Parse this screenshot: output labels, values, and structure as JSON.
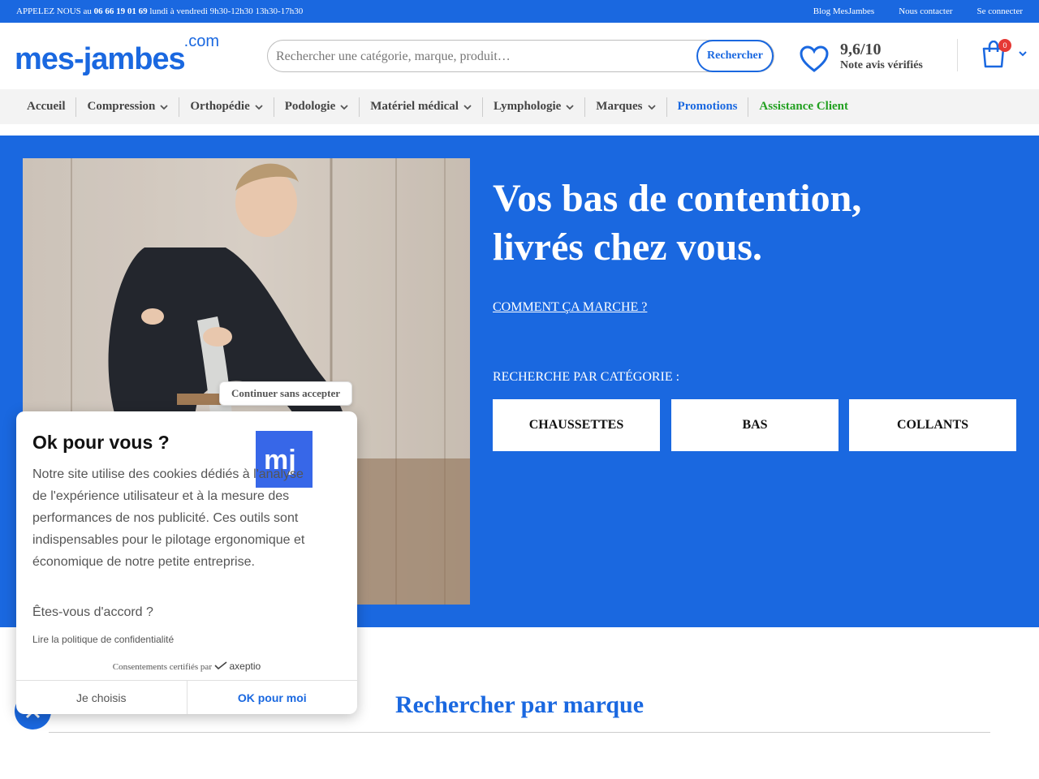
{
  "topbar": {
    "call_prefix": "APPELEZ NOUS au ",
    "phone": "06 66 19 01 69",
    "hours": " lundi à vendredi 9h30-12h30 13h30-17h30",
    "links": [
      "Blog MesJambes",
      "Nous contacter",
      "Se connecter"
    ]
  },
  "header": {
    "logo_main": "mes-jambes",
    "logo_com": ".com",
    "search_placeholder": "Rechercher une catégorie, marque, produit…",
    "search_button": "Rechercher",
    "rating_score": "9,6/10",
    "rating_label": "Note avis vérifiés",
    "cart_count": "0"
  },
  "nav": {
    "items": [
      "Accueil",
      "Compression",
      "Orthopédie",
      "Podologie",
      "Matériel médical",
      "Lymphologie",
      "Marques",
      "Promotions",
      "Assistance Client"
    ]
  },
  "hero": {
    "title_line1": "Vos bas de contention,",
    "title_line2": "livrés chez vous.",
    "how_link": "COMMENT ÇA MARCHE ?",
    "category_label": "RECHERCHE PAR CATÉGORIE :",
    "categories": [
      "CHAUSSETTES",
      "BAS",
      "COLLANTS"
    ]
  },
  "brands": {
    "title": "Rechercher par marque"
  },
  "cookie": {
    "continue": "Continuer sans accepter",
    "title": "Ok pour vous ?",
    "text": "Notre site utilise des cookies dédiés à l'analyse de l'expérience utilisateur et à la mesure des performances de nos publicité. Ces outils sont indispensables pour le pilotage ergonomique et économique de notre petite entreprise.",
    "question": "Êtes-vous d'accord ?",
    "policy": "Lire la politique de confidentialité",
    "cert_prefix": "Consentements certifiés par",
    "cert_brand": "axeptio",
    "btn_choose": "Je choisis",
    "btn_ok": "OK pour moi",
    "logo_text": "mj"
  },
  "colors": {
    "brand_blue": "#1a68e0",
    "assist_green": "#22a020",
    "badge_red": "#e53935"
  }
}
